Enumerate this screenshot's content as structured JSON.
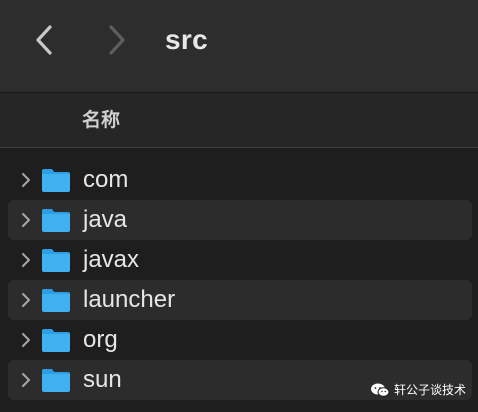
{
  "window": {
    "title": "src",
    "back_icon": "chevron-left-icon",
    "forward_icon": "chevron-right-icon"
  },
  "header": {
    "column_name": "名称"
  },
  "items": [
    {
      "name": "com",
      "icon": "folder-icon"
    },
    {
      "name": "java",
      "icon": "folder-icon"
    },
    {
      "name": "javax",
      "icon": "folder-icon"
    },
    {
      "name": "launcher",
      "icon": "folder-icon"
    },
    {
      "name": "org",
      "icon": "folder-icon"
    },
    {
      "name": "sun",
      "icon": "folder-icon"
    }
  ],
  "watermark": {
    "text": "轩公子谈技术",
    "icon": "wechat-icon"
  },
  "colors": {
    "folder": "#3fb0f0",
    "background": "#1e1e1e",
    "toolbar": "#2d2d2d"
  }
}
